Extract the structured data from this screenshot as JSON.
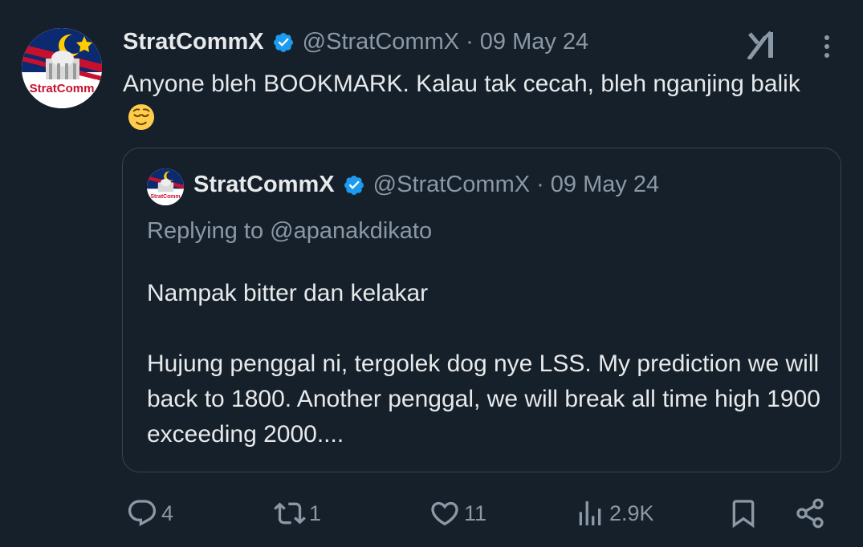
{
  "tweet": {
    "author_name": "StratCommX",
    "author_handle": "@StratCommX",
    "separator": "·",
    "date": "09 May 24",
    "avatar_text": "StratComm",
    "text": "Anyone bleh BOOKMARK. Kalau tak cecah, bleh nganjing balik",
    "emoji_icon": "relieved-face-emoji"
  },
  "quote": {
    "author_name": "StratCommX",
    "author_handle": "@StratCommX",
    "separator": "·",
    "date": "09 May 24",
    "avatar_text": "StratComm",
    "replying_to": "Replying to @apanakdikato",
    "paragraph1": "Nampak bitter dan kelakar",
    "paragraph2": "Hujung penggal ni, tergolek dog nye LSS. My prediction we will back to 1800. Another penggal, we will break all time high 1900 exceeding 2000...."
  },
  "actions": {
    "replies": "4",
    "reposts": "1",
    "likes": "11",
    "views": "2.9K"
  },
  "colors": {
    "background": "#15202b",
    "text": "#e7e9ea",
    "secondary": "#8b98a5",
    "verified": "#1d9bf0",
    "border": "#38444d"
  }
}
